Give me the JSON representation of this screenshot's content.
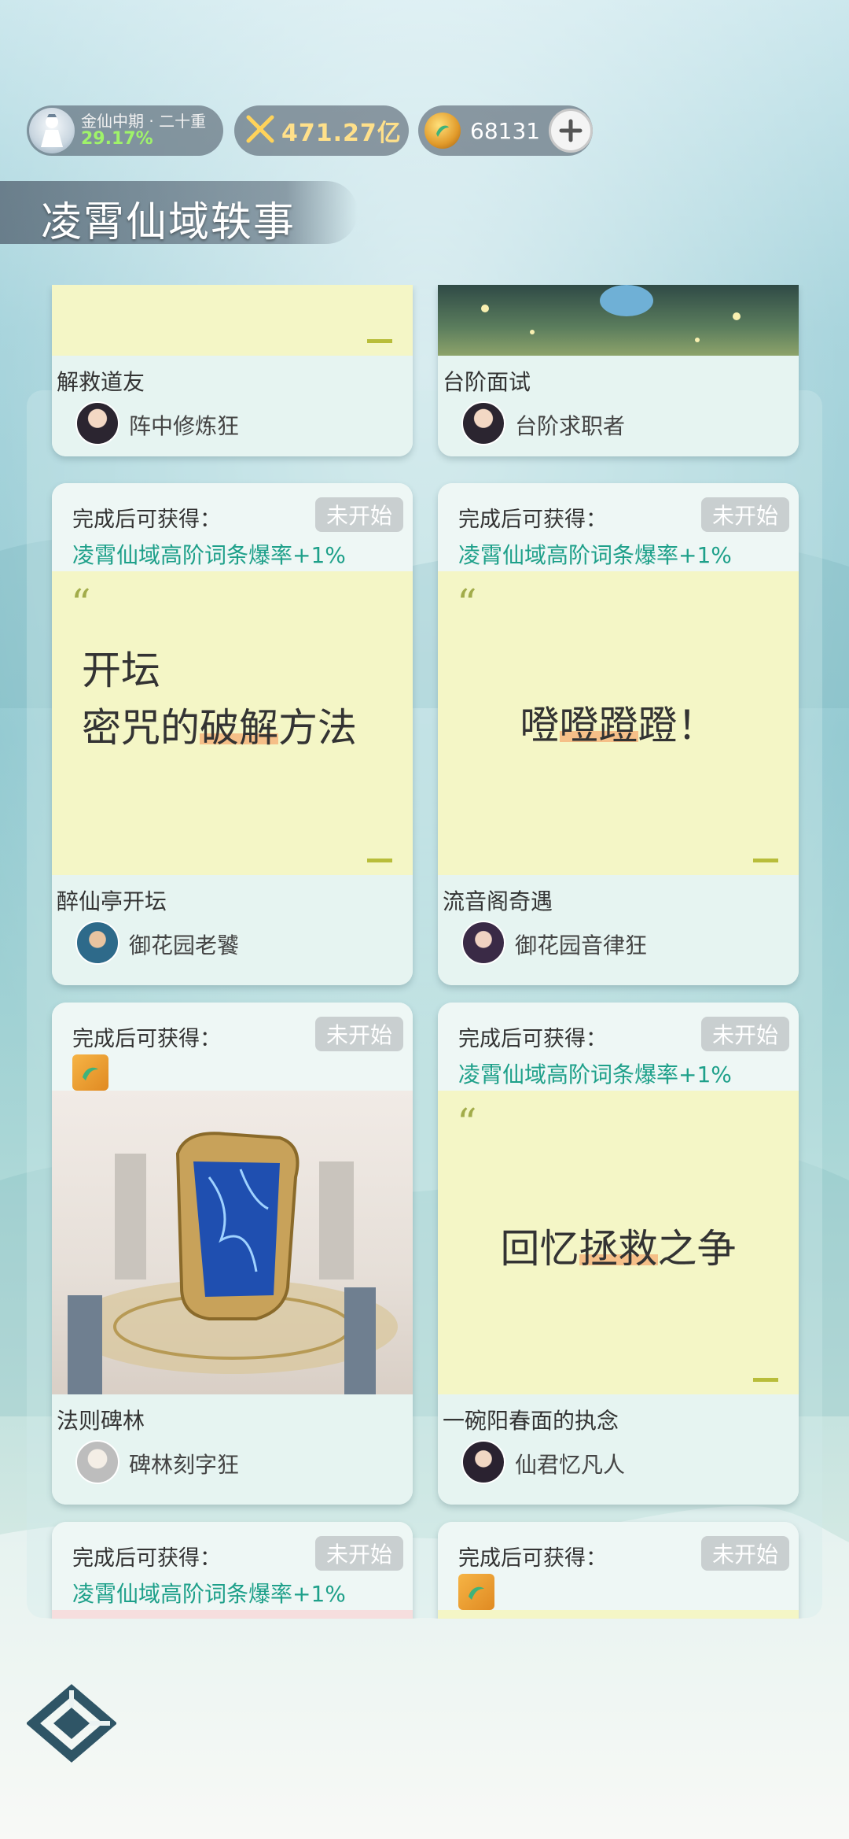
{
  "status": {
    "realm_name": "金仙中期 · 二十重",
    "realm_progress": "29.17%",
    "power": "471.27亿",
    "jade": "68131"
  },
  "title": "凌霄仙域轶事",
  "labels": {
    "reward_label": "完成后可获得：",
    "not_started": "未开始"
  },
  "cards": [
    {
      "event": "解救道友",
      "npc": "阵中修炼狂"
    },
    {
      "event": "台阶面试",
      "npc": "台阶求职者"
    },
    {
      "reward": "凌霄仙域高阶词条爆率+1%",
      "lines": [
        "开坛",
        "密咒的破解方法"
      ],
      "event": "醉仙亭开坛",
      "npc": "御花园老饕"
    },
    {
      "reward": "凌霄仙域高阶词条爆率+1%",
      "lines": [
        "噔噔蹬蹬！"
      ],
      "event": "流音阁奇遇",
      "npc": "御花园音律狂"
    },
    {
      "event": "法则碑林",
      "npc": "碑林刻字狂"
    },
    {
      "reward": "凌霄仙域高阶词条爆率+1%",
      "lines": [
        "回忆拯救之争"
      ],
      "event": "一碗阳春面的执念",
      "npc": "仙君忆凡人"
    },
    {
      "reward": "凌霄仙域高阶词条爆率+1%"
    },
    {}
  ]
}
